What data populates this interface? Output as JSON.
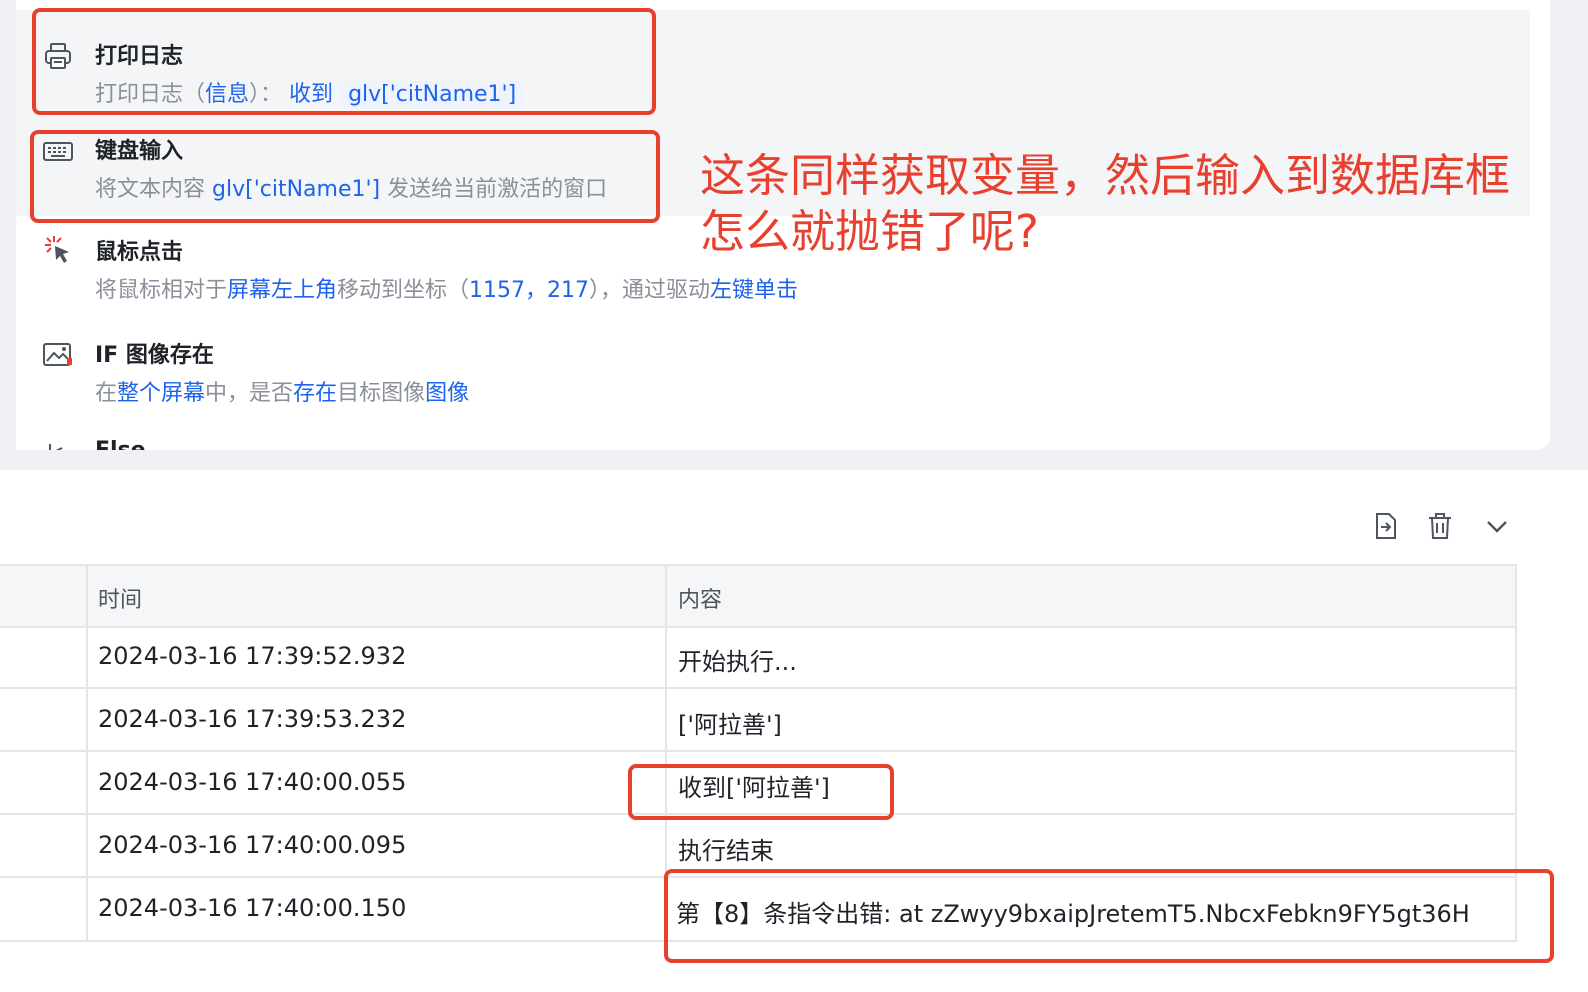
{
  "workflow": {
    "steps": [
      {
        "title": "打印日志",
        "desc": {
          "pre": "打印日志（",
          "kw": "信息",
          "post": "）：",
          "kw2": "收到",
          "pill": "glv['citName1']"
        }
      },
      {
        "title": "键盘输入",
        "desc": {
          "pre": "将文本内容",
          "pill": "glv['citName1']",
          "post": "发送给当前激活的窗口"
        }
      },
      {
        "title": "鼠标点击",
        "desc": {
          "pre": "将鼠标相对于",
          "kw": "屏幕左上角",
          "mid": "移动到坐标（",
          "coords": "1157，217",
          "post": "），通过驱动",
          "kw2": "左键单击"
        }
      },
      {
        "title": "IF 图像存在",
        "desc": {
          "pre": "在",
          "kw": "整个屏幕",
          "mid": "中，是否",
          "kw2": "存在",
          "mid2": "目标图像",
          "kw3": "图像"
        }
      },
      {
        "title": "Else"
      }
    ]
  },
  "annotation": {
    "line1": "这条同样获取变量，然后输入到数据库框",
    "line2": "怎么就抛错了呢?"
  },
  "log": {
    "columns": {
      "time": "时间",
      "content": "内容"
    },
    "rows": [
      {
        "time": "2024-03-16 17:39:52.932",
        "content": "开始执行..."
      },
      {
        "time": "2024-03-16 17:39:53.232",
        "content": "['阿拉善']"
      },
      {
        "time": "2024-03-16 17:40:00.055",
        "content": "收到['阿拉善']"
      },
      {
        "time": "2024-03-16 17:40:00.095",
        "content": "执行结束"
      },
      {
        "time": "2024-03-16 17:40:00.150",
        "content": "第【8】条指令出错:  at zZwyy9bxaipJretemT5.NbcxFebkn9FY5gt36H"
      }
    ]
  },
  "colors": {
    "accent": "#1d63ed",
    "annotation": "#e8402f"
  }
}
